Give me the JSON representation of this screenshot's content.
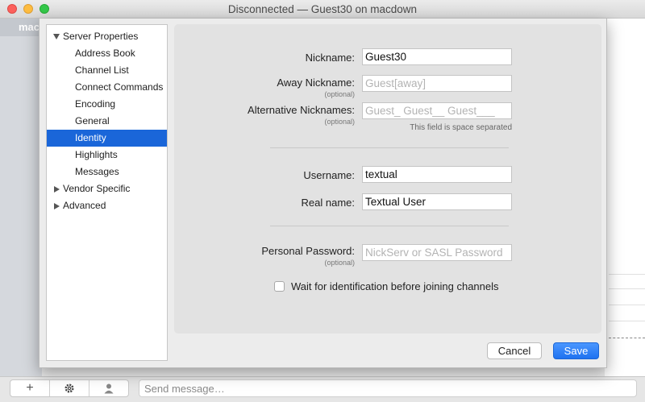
{
  "window": {
    "title": "Disconnected — Guest30 on macdown"
  },
  "background": {
    "sidebar_label": "macd",
    "message_placeholder": "Send message…",
    "toolbar": {
      "add_label": "+",
      "settings_icon": "gear-icon",
      "user_icon": "user-icon"
    }
  },
  "sidebar": {
    "items": [
      {
        "label": "Server Properties",
        "expander": "expanded"
      },
      {
        "label": "Address Book"
      },
      {
        "label": "Channel List"
      },
      {
        "label": "Connect Commands"
      },
      {
        "label": "Encoding"
      },
      {
        "label": "General"
      },
      {
        "label": "Identity",
        "selected": true
      },
      {
        "label": "Highlights"
      },
      {
        "label": "Messages"
      },
      {
        "label": "Vendor Specific",
        "expander": "collapsed"
      },
      {
        "label": "Advanced",
        "expander": "collapsed"
      }
    ]
  },
  "form": {
    "nickname": {
      "label": "Nickname:",
      "value": "Guest30"
    },
    "away_nickname": {
      "label": "Away Nickname:",
      "sublabel": "(optional)",
      "placeholder": "Guest[away]"
    },
    "alt_nicknames": {
      "label": "Alternative Nicknames:",
      "sublabel": "(optional)",
      "placeholder": "Guest_ Guest__ Guest___",
      "hint": "This field is space separated"
    },
    "username": {
      "label": "Username:",
      "value": "textual"
    },
    "real_name": {
      "label": "Real name:",
      "value": "Textual User"
    },
    "personal_password": {
      "label": "Personal Password:",
      "sublabel": "(optional)",
      "placeholder": "NickServ or SASL Password"
    },
    "wait_identification": {
      "label": "Wait for identification before joining channels",
      "checked": false
    }
  },
  "buttons": {
    "cancel": "Cancel",
    "save": "Save"
  },
  "colors": {
    "selection": "#1a66d9",
    "save_button": "#1f72f0"
  }
}
